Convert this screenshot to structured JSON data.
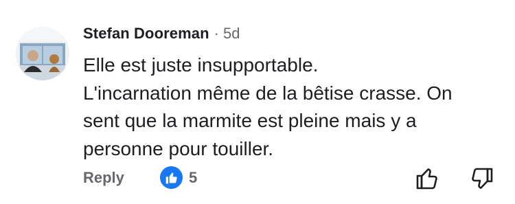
{
  "comment": {
    "author": "Stefan Dooreman",
    "separator": "·",
    "time": "5d",
    "lines": [
      "Elle est juste insupportable.",
      "L'incarnation même de la bêtise crasse. On sent que la marmite est pleine mais y a personne pour touiller."
    ]
  },
  "actions": {
    "reply_label": "Reply",
    "reaction_count": "5",
    "reaction_icon": "like-icon",
    "upvote_icon": "thumbs-up-icon",
    "downvote_icon": "thumbs-down-icon"
  },
  "colors": {
    "text": "#1c1e21",
    "secondary": "#65676b",
    "like_blue": "#1877f2"
  }
}
